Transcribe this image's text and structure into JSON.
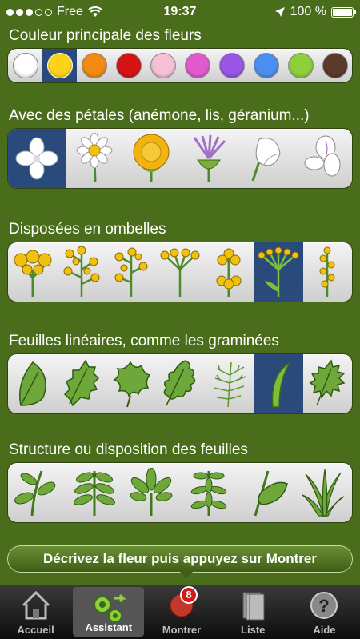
{
  "status": {
    "carrier": "Free",
    "time": "19:37",
    "battery": "100 %"
  },
  "sections": {
    "colors": {
      "title": "Couleur principale des fleurs"
    },
    "petals": {
      "title": "Avec des pétales (anémone, lis, géranium...)"
    },
    "umbels": {
      "title": "Disposées en ombelles"
    },
    "leaves": {
      "title": "Feuilles linéaires, comme les graminées"
    },
    "structure": {
      "title": "Structure ou disposition des feuilles"
    }
  },
  "colors": [
    "#ffffff",
    "#ffd21a",
    "#f28a14",
    "#d61414",
    "#f6c0d8",
    "#e05acd",
    "#9a55e6",
    "#4a8ff0",
    "#8fcf3c",
    "#5a3a2a"
  ],
  "banner": "Décrivez la fleur puis appuyez sur Montrer",
  "tabs": [
    {
      "label": "Accueil"
    },
    {
      "label": "Assistant"
    },
    {
      "label": "Montrer",
      "badge": "8"
    },
    {
      "label": "Liste"
    },
    {
      "label": "Aide"
    }
  ]
}
